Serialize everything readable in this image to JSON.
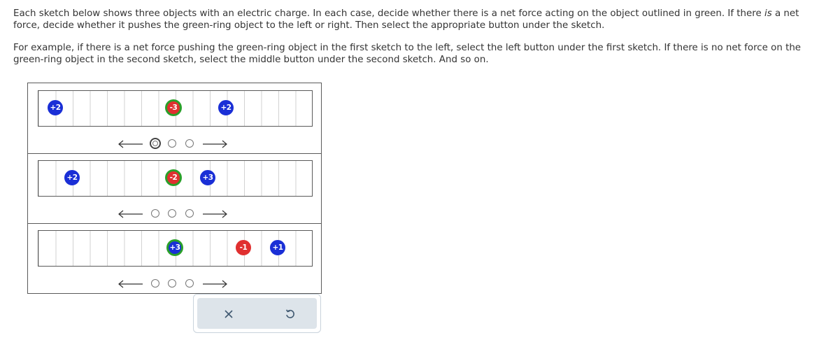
{
  "instructions": {
    "p1_part1": "Each sketch below shows three objects with an electric charge. In each case, decide whether there is a net force acting on the object outlined in green. If there",
    "p1_italic": "is",
    "p1_part2": " a net force, decide whether it pushes the green-ring object to the left or right. Then select the appropriate button under the sketch.",
    "p2": "For example, if there is a net force pushing the green-ring object in the first sketch to the left, select the left button under the first sketch. If there is no net force on the green-ring object in the second sketch, select the middle button under the second sketch. And so on."
  },
  "sketches": [
    {
      "charges": [
        {
          "label": "+2",
          "sign": "positive",
          "green_ring": false
        },
        {
          "label": "-3",
          "sign": "negative",
          "green_ring": true
        },
        {
          "label": "+2",
          "sign": "positive",
          "green_ring": false
        }
      ],
      "selected_option": "left"
    },
    {
      "charges": [
        {
          "label": "+2",
          "sign": "positive",
          "green_ring": false
        },
        {
          "label": "-2",
          "sign": "negative",
          "green_ring": true
        },
        {
          "label": "+3",
          "sign": "positive",
          "green_ring": false
        }
      ],
      "selected_option": null
    },
    {
      "charges": [
        {
          "label": "+3",
          "sign": "positive",
          "green_ring": true
        },
        {
          "label": "-1",
          "sign": "negative",
          "green_ring": false
        },
        {
          "label": "+1",
          "sign": "positive",
          "green_ring": false
        }
      ],
      "selected_option": null
    }
  ],
  "actions": {
    "clear_icon": "x-icon",
    "undo_icon": "undo-icon"
  },
  "colors": {
    "positive": "#1a2fd6",
    "negative": "#e03030",
    "green_ring": "#2aa02a"
  }
}
